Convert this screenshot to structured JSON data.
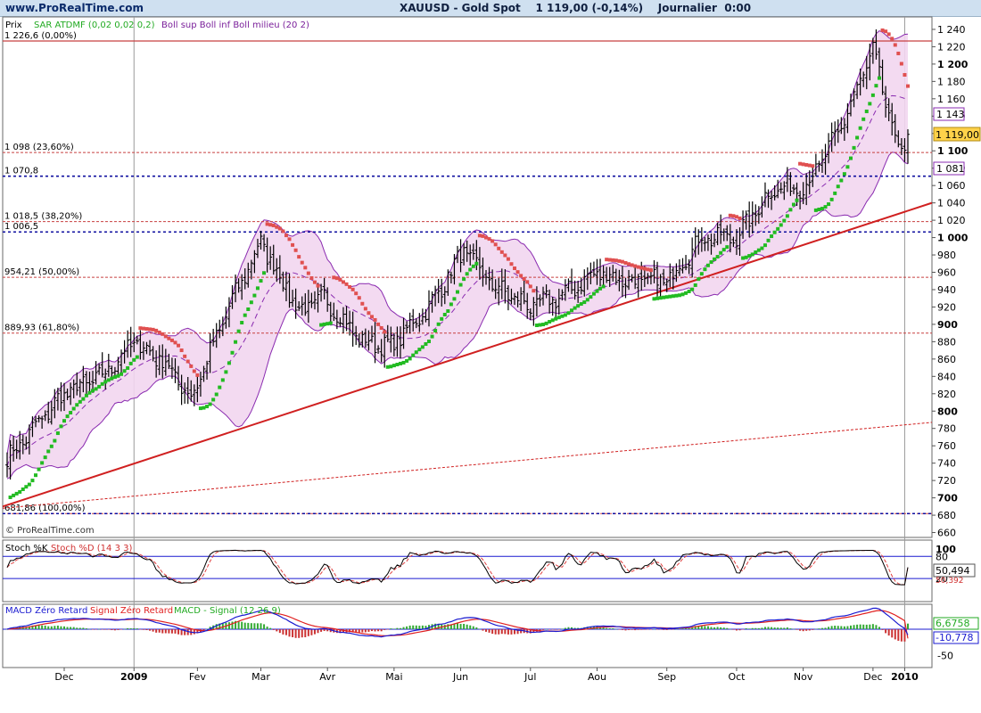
{
  "header": {
    "site": "www.ProRealTime.com",
    "title": "XAUUSD - Gold Spot    1 119,00 (-0,14%)    Journalier  0:00"
  },
  "colors": {
    "sar_up": "#22bb22",
    "sar_down": "#e05050",
    "boll_line": "#8a2bb0",
    "boll_fill": "#f2d6ef",
    "trend": "#d02020",
    "fibo": "#c84040",
    "level_blue": "#1010a0",
    "price_box": "#ffd24a",
    "stoch_k": "#000000",
    "stoch_d": "#e04040",
    "macd_line": "#1a1ad0",
    "signal_line": "#e02020",
    "hist_pos": "#33aa33",
    "hist_neg": "#cc3333"
  },
  "main_panel": {
    "label_prix": "Prix",
    "label_sar": "SAR ATDMF (0,02 0,02 0,2)",
    "label_boll": "Boll sup Boll inf Boll milieu (20 2)",
    "copyright": "© ProRealTime.com",
    "y_ticks": [
      "1 240",
      "1 220",
      "1 200",
      "1 180",
      "1 160",
      "1 140",
      "1 120",
      "1 100",
      "1 080",
      "1 060",
      "1 040",
      "1 020",
      "1 000",
      "980",
      "960",
      "940",
      "920",
      "900",
      "880",
      "860",
      "840",
      "820",
      "800",
      "780",
      "760",
      "740",
      "720",
      "700",
      "680",
      "660"
    ],
    "fib_labels": [
      "1 226,6 (0,00%)",
      "1 098 (23,60%)",
      "1 018,5 (38,20%)",
      "954,21 (50,00%)",
      "889,93 (61,80%)",
      "681,86 (100,00%)"
    ],
    "level_labels": [
      "1 070,8",
      "1 006,5"
    ],
    "last_price": "1 119,00",
    "boll_upper_val": "1 143",
    "boll_lower_val": "1 081"
  },
  "stoch_panel": {
    "label_k": "Stoch %K",
    "label_d": "Stoch %D (14 3 3)",
    "y_ticks": [
      "100",
      "80",
      "20"
    ],
    "value": "50,494",
    "value2": "50,392"
  },
  "macd_panel": {
    "label_macd": "MACD Zéro Retard",
    "label_signal": "Signal Zéro Retard",
    "label_hist": "MACD - Signal (12 26 9)",
    "y_ticks": [
      "-50"
    ],
    "value_hist": "6,6758",
    "value_macd": "-10,778"
  },
  "x_axis": {
    "months": [
      "Dec",
      "2009",
      "Fev",
      "Mar",
      "Avr",
      "Mai",
      "Jun",
      "Jul",
      "Aou",
      "Sep",
      "Oct",
      "Nov",
      "Dec",
      "2010"
    ]
  },
  "chart_data": {
    "type": "ohlc",
    "title": "XAUUSD - Gold Spot",
    "x_range": [
      "Nov 2008",
      "Dec 2009"
    ],
    "ylim": [
      650,
      1250
    ],
    "close_anchors": [
      {
        "x": "Nov 2008 start",
        "y": 745
      },
      {
        "x": "Nov 2008 end",
        "y": 820
      },
      {
        "x": "Dec 2008 mid",
        "y": 840
      },
      {
        "x": "Jan 2009 start",
        "y": 880
      },
      {
        "x": "Jan 2009 mid",
        "y": 855
      },
      {
        "x": "Jan 2009 end",
        "y": 815
      },
      {
        "x": "Feb 2009 mid",
        "y": 920
      },
      {
        "x": "Feb 2009 end",
        "y": 995
      },
      {
        "x": "Mar 2009 mid",
        "y": 915
      },
      {
        "x": "Mar 2009 end",
        "y": 930
      },
      {
        "x": "Apr 2009 mid",
        "y": 880
      },
      {
        "x": "Apr 2009 end",
        "y": 875
      },
      {
        "x": "May 2009 mid",
        "y": 920
      },
      {
        "x": "Jun 2009 start",
        "y": 985
      },
      {
        "x": "Jun 2009 mid",
        "y": 945
      },
      {
        "x": "Jul 2009 start",
        "y": 920
      },
      {
        "x": "Jul 2009 mid",
        "y": 935
      },
      {
        "x": "Aug 2009 start",
        "y": 960
      },
      {
        "x": "Aug 2009 mid",
        "y": 950
      },
      {
        "x": "Sep 2009 start",
        "y": 950
      },
      {
        "x": "Sep 2009 mid",
        "y": 1000
      },
      {
        "x": "Oct 2009 start",
        "y": 1000
      },
      {
        "x": "Oct 2009 mid",
        "y": 1055
      },
      {
        "x": "Nov 2009 start",
        "y": 1060
      },
      {
        "x": "Nov 2009 mid",
        "y": 1120
      },
      {
        "x": "Dec 2009 start",
        "y": 1215
      },
      {
        "x": "Dec 2009 mid",
        "y": 1125
      },
      {
        "x": "Dec 2009 late",
        "y": 1095
      },
      {
        "x": "Dec 2009 end",
        "y": 1119
      }
    ],
    "fibonacci_levels": [
      1226.6,
      1098,
      1018.5,
      954.21,
      889.93,
      681.86
    ],
    "horizontal_levels": [
      1070.8,
      1006.5
    ],
    "trendline": [
      {
        "x": "Nov 2008",
        "y": 690
      },
      {
        "x": "Dec 2009",
        "y": 1040
      }
    ],
    "secondary_trendline": [
      {
        "x": "Nov 2008",
        "y": 688
      },
      {
        "x": "Dec 2009",
        "y": 787
      }
    ],
    "bollinger_last": {
      "upper": 1143,
      "lower": 1081
    },
    "last_close": 1119.0,
    "change_pct": -0.14,
    "stochastic_last": {
      "k": 50.494,
      "d": 50.392
    },
    "macd_last": {
      "histogram": 6.6758,
      "macd": -10.778
    }
  }
}
